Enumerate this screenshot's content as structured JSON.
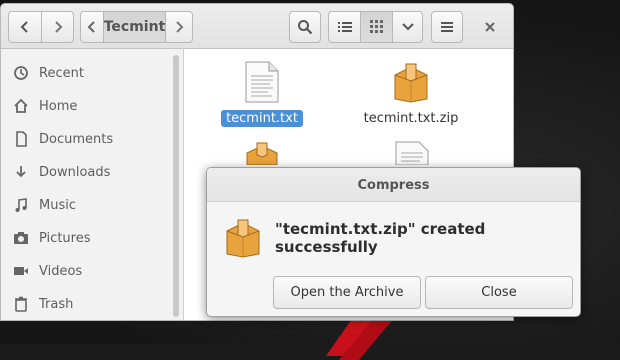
{
  "colors": {
    "selection": "#4a90d9",
    "archive_orange": "#e8a33d"
  },
  "toolbar": {
    "back_icon": "chevron-left-icon",
    "forward_icon": "chevron-right-icon",
    "path_left_icon": "chevron-left-icon",
    "path_right_icon": "chevron-right-icon",
    "path_label": "Tecmint",
    "search_icon": "search-icon",
    "list_view_icon": "list-view-icon",
    "grid_view_icon": "grid-view-icon",
    "view_options_icon": "chevron-down-icon",
    "menu_icon": "hamburger-menu-icon",
    "close_icon": "close-icon"
  },
  "sidebar": {
    "items": [
      {
        "label": "Recent",
        "icon": "clock-icon"
      },
      {
        "label": "Home",
        "icon": "home-icon"
      },
      {
        "label": "Documents",
        "icon": "document-icon"
      },
      {
        "label": "Downloads",
        "icon": "download-icon"
      },
      {
        "label": "Music",
        "icon": "music-icon"
      },
      {
        "label": "Pictures",
        "icon": "camera-icon"
      },
      {
        "label": "Videos",
        "icon": "video-icon"
      },
      {
        "label": "Trash",
        "icon": "trash-icon"
      }
    ]
  },
  "files": [
    {
      "name": "tecmint.txt",
      "icon": "text-file-icon",
      "selected": true
    },
    {
      "name": "tecmint.txt.zip",
      "icon": "archive-icon",
      "selected": false
    }
  ],
  "dialog": {
    "title": "Compress",
    "message": "\"tecmint.txt.zip\" created successfully",
    "icon": "archive-icon",
    "open_button": "Open the Archive",
    "close_button": "Close"
  }
}
